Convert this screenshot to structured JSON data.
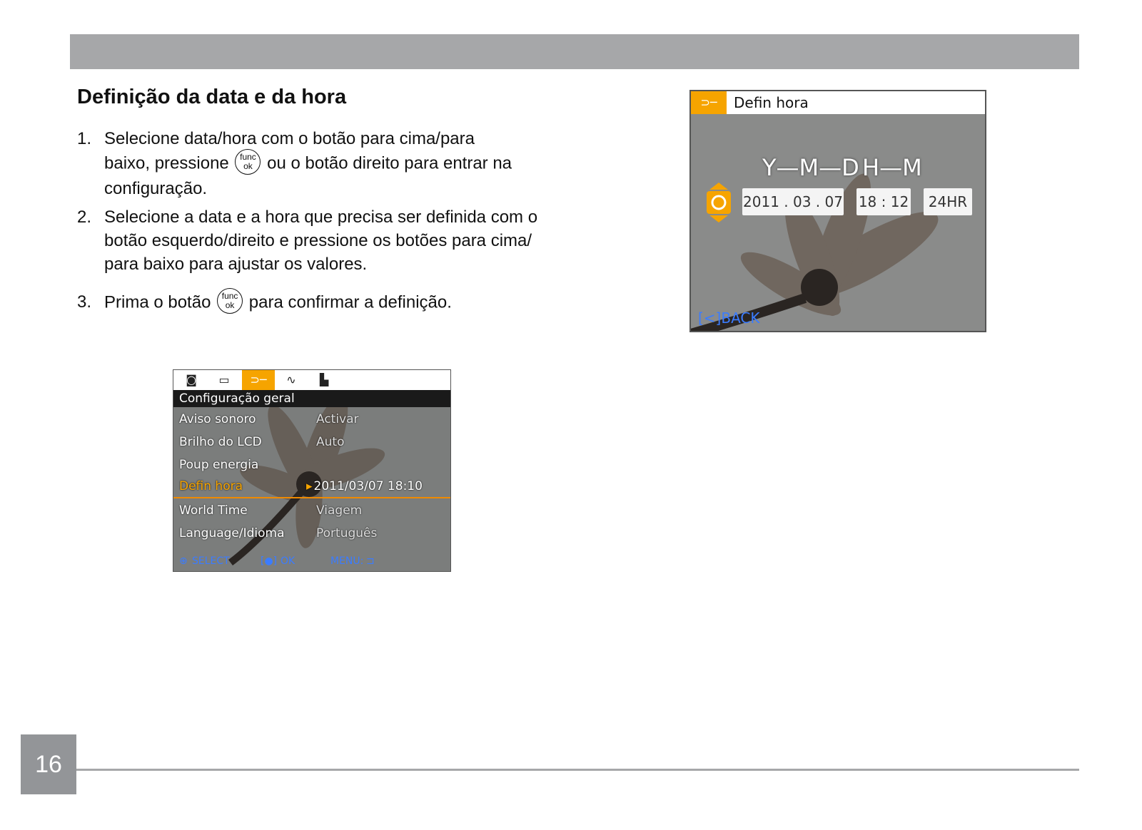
{
  "heading": "Definição da data e da hora",
  "steps": {
    "s1_num": "1.",
    "s1_a": "Selecione data/hora com o botão para cima/para",
    "s1_b": "baixo, pressione",
    "s1_c": "ou o botão direito para entrar na",
    "s1_d": "configuração.",
    "s2_num": "2.",
    "s2_a": "Selecione a data e a hora que precisa ser definida com o",
    "s2_b": "botão esquerdo/direito e pressione os botões para cima/",
    "s2_c": "para baixo para ajustar os valores.",
    "s3_num": "3.",
    "s3_a": "Prima o botão",
    "s3_b": "para confirmar a definição."
  },
  "func_ok": {
    "top": "func",
    "bottom": "ok"
  },
  "settings_screen": {
    "header": "Configuração geral",
    "rows": [
      {
        "label": "Aviso sonoro",
        "value": "Activar"
      },
      {
        "label": "Brilho do LCD",
        "value": "Auto"
      },
      {
        "label": "Poup energia",
        "value": ""
      },
      {
        "label": "Defin hora",
        "value": "2011/03/07  18:10"
      },
      {
        "label": "World Time",
        "value": "Viagem"
      },
      {
        "label": "Language/Idioma",
        "value": "Português"
      }
    ],
    "footer": {
      "select": "SELECT",
      "ok": "OK",
      "menu": "MENU:"
    }
  },
  "date_screen": {
    "title": "Defin hora",
    "ymd_label": "Y—M—D",
    "hm_label": "H—M",
    "year": "2011",
    "month": "03",
    "day": "07",
    "hour": "18",
    "minute": "12",
    "format": "24HR",
    "back": "BACK"
  },
  "page_number": "16",
  "colors": {
    "accent": "#f6a400",
    "bar_gray": "#a6a7a9",
    "link_blue": "#3b7cff"
  }
}
